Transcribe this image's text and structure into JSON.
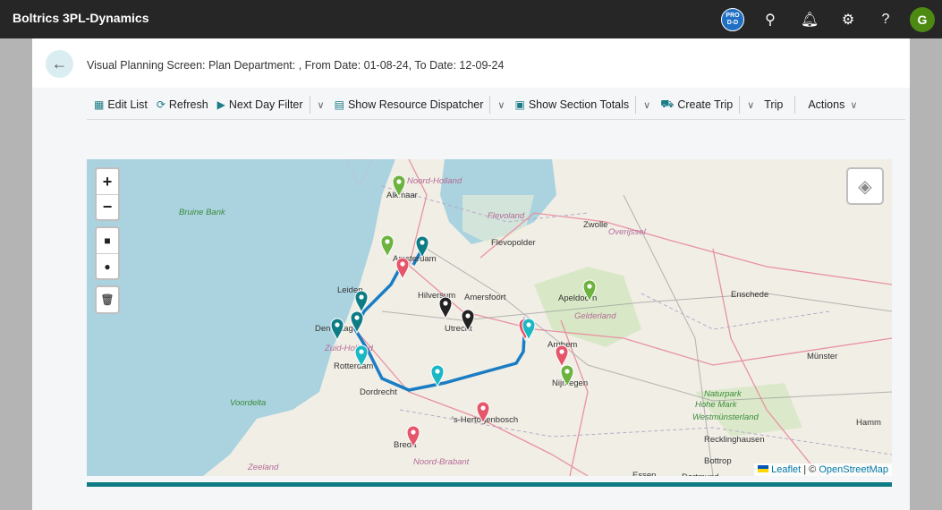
{
  "topbar": {
    "title": "Boltrics 3PL-Dynamics",
    "env_badge": "PRO D-D",
    "avatar_initial": "G",
    "icons": [
      "search-icon",
      "bell-icon",
      "gear-icon",
      "help-icon"
    ]
  },
  "page": {
    "breadcrumb": "Visual Planning Screen: Plan Department: , From Date: 01-08-24, To Date: 12-09-24"
  },
  "actions": {
    "edit_list": "Edit List",
    "refresh": "Refresh",
    "next_day_filter": "Next Day Filter",
    "show_resource_dispatcher": "Show Resource Dispatcher",
    "show_section_totals": "Show Section Totals",
    "create_trip": "Create Trip",
    "trip": "Trip",
    "actions": "Actions"
  },
  "map": {
    "zoom_in": "+",
    "zoom_out": "−",
    "attribution": {
      "leaflet": "Leaflet",
      "sep": " | © ",
      "osm": "OpenStreetMap"
    },
    "labels": [
      "Alkmaar",
      "Noord-Holland",
      "Flevoland",
      "Flevopolder",
      "Zwolle",
      "Overijssel",
      "Amsterdam",
      "Hilversum",
      "Amersfoort",
      "Apeldoorn",
      "Gelderland",
      "Enschede",
      "Leiden",
      "Den Haag",
      "Zuid-Holland",
      "Utrecht",
      "Rotterdam",
      "Arnhem",
      "Nijmegen",
      "Dordrecht",
      "'s-Hertogenbosch",
      "Breda",
      "Noord-Brabant",
      "Voordelta",
      "Zeeland",
      "Bruine Bank",
      "Naturpark",
      "Hohe Mark",
      "Westmünsterland",
      "Münster",
      "Hamm",
      "Recklinghausen",
      "Bottrop",
      "Essen",
      "Dortmund"
    ],
    "marker_colors": {
      "green": "#6db33f",
      "teal": "#0e7c84",
      "pink": "#e5566b",
      "black": "#222222",
      "cyan": "#19b8c4"
    },
    "route_color": "#1a7dc4"
  }
}
